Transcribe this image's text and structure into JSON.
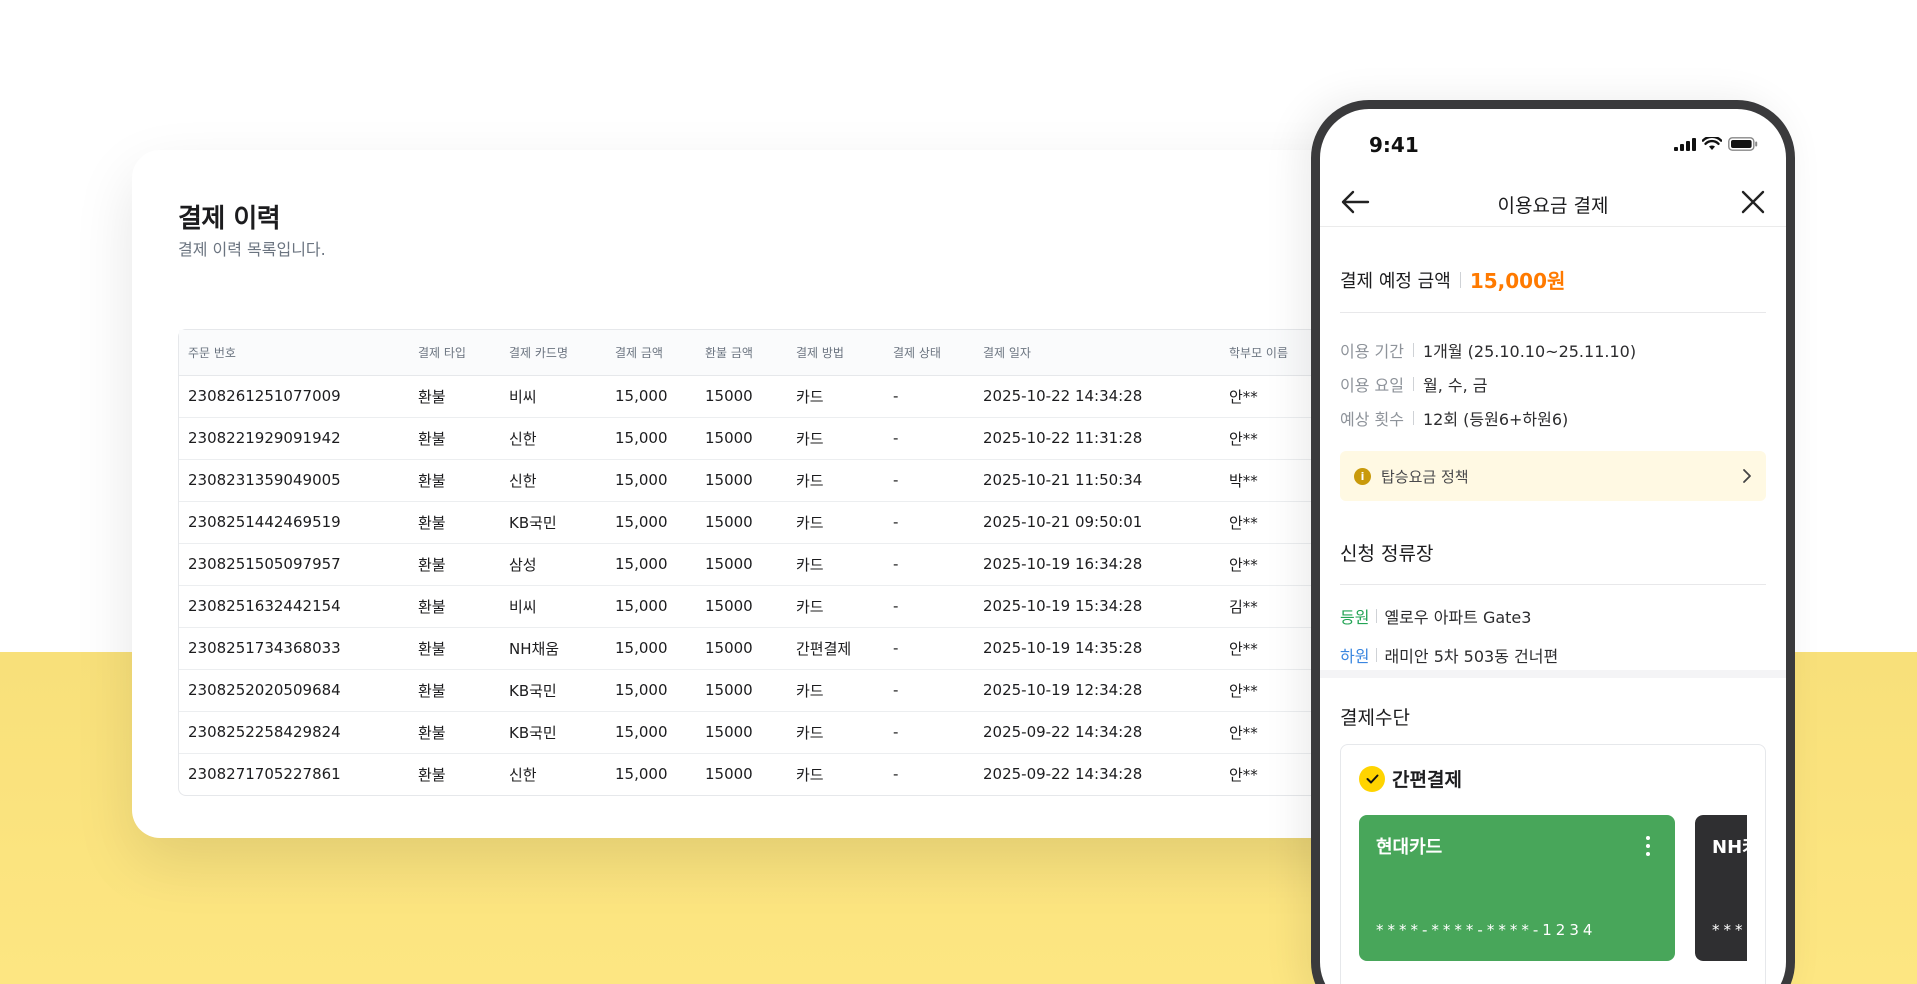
{
  "colors": {
    "background_yellow": "#fde682",
    "accent_orange": "#ff7a00",
    "boarding_green": "#23a455",
    "dropoff_blue": "#3a86e0",
    "card_green": "#48a65a",
    "card_dark": "#2f2f31",
    "check_yellow": "#ffd400"
  },
  "history": {
    "title": "결제 이력",
    "subtitle": "결제 이력 목록입니다.",
    "columns": [
      "주문 번호",
      "결제 타입",
      "결제 카드명",
      "결제 금액",
      "환불 금액",
      "결제 방법",
      "결제 상태",
      "결제 일자",
      "학부모 이름"
    ],
    "rows": [
      [
        "2308261251077009",
        "환불",
        "비씨",
        "15,000",
        "15000",
        "카드",
        "-",
        "2025-10-22 14:34:28",
        "안**"
      ],
      [
        "2308221929091942",
        "환불",
        "신한",
        "15,000",
        "15000",
        "카드",
        "-",
        "2025-10-22 11:31:28",
        "안**"
      ],
      [
        "2308231359049005",
        "환불",
        "신한",
        "15,000",
        "15000",
        "카드",
        "-",
        "2025-10-21 11:50:34",
        "박**"
      ],
      [
        "2308251442469519",
        "환불",
        "KB국민",
        "15,000",
        "15000",
        "카드",
        "-",
        "2025-10-21 09:50:01",
        "안**"
      ],
      [
        "2308251505097957",
        "환불",
        "삼성",
        "15,000",
        "15000",
        "카드",
        "-",
        "2025-10-19 16:34:28",
        "안**"
      ],
      [
        "2308251632442154",
        "환불",
        "비씨",
        "15,000",
        "15000",
        "카드",
        "-",
        "2025-10-19 15:34:28",
        "김**"
      ],
      [
        "2308251734368033",
        "환불",
        "NH채움",
        "15,000",
        "15000",
        "간편결제",
        "-",
        "2025-10-19 14:35:28",
        "안**"
      ],
      [
        "2308252020509684",
        "환불",
        "KB국민",
        "15,000",
        "15000",
        "카드",
        "-",
        "2025-10-19 12:34:28",
        "안**"
      ],
      [
        "2308252258429824",
        "환불",
        "KB국민",
        "15,000",
        "15000",
        "카드",
        "-",
        "2025-09-22 14:34:28",
        "안**"
      ],
      [
        "2308271705227861",
        "환불",
        "신한",
        "15,000",
        "15000",
        "카드",
        "-",
        "2025-09-22 14:34:28",
        "안**"
      ]
    ]
  },
  "phone": {
    "status_time": "9:41",
    "status_icons": [
      "signal-icon",
      "wifi-icon",
      "battery-icon"
    ],
    "nav": {
      "title": "이용요금 결제",
      "back_icon": "arrow-left-icon",
      "close_icon": "close-icon"
    },
    "amount": {
      "label": "결제 예정 금액",
      "value": "15,000원"
    },
    "info": [
      {
        "key": "이용 기간",
        "value": "1개월 (25.10.10~25.11.10)"
      },
      {
        "key": "이용 요일",
        "value": "월, 수, 금"
      },
      {
        "key": "예상 횟수",
        "value": "12회 (등원6+하원6)"
      }
    ],
    "policy": {
      "icon_text": "i",
      "label": "탑승요금 정책"
    },
    "stops": {
      "title": "신청 정류장",
      "boarding": {
        "tag": "등원",
        "name": "옐로우 아파트 Gate3"
      },
      "dropoff": {
        "tag": "하원",
        "name": "래미안 5차 503동 건너편"
      }
    },
    "payment": {
      "title": "결제수단",
      "method": "간편결제",
      "cards": [
        {
          "name": "현대카드",
          "number": "****-****-****-1234"
        },
        {
          "name": "NH카드",
          "number": "****"
        }
      ]
    }
  }
}
